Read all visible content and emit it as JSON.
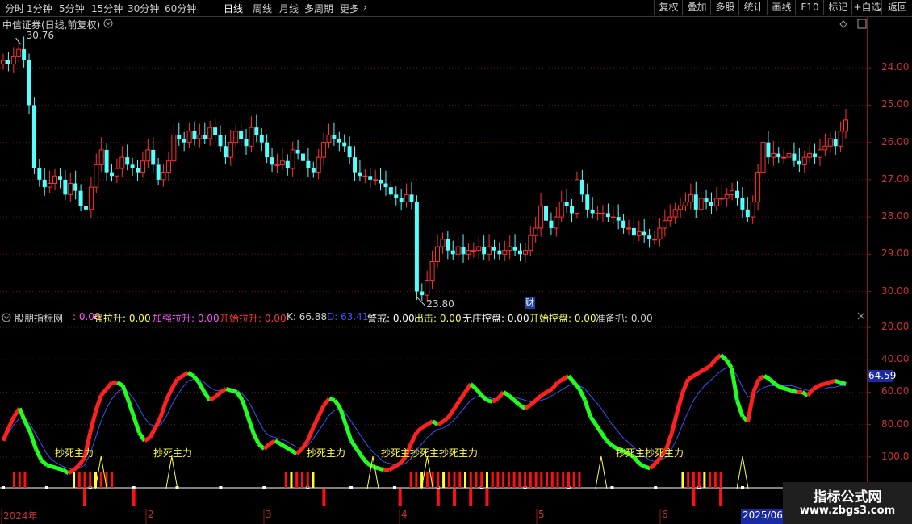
{
  "toolbar": {
    "timeframes": [
      "分时",
      "1分钟",
      "5分钟",
      "15分钟",
      "30分钟",
      "60分钟",
      "日线",
      "周线",
      "月线",
      "多周期",
      "更多"
    ],
    "active": "日线",
    "more_arrow": "›",
    "right_buttons": [
      "复权",
      "叠加",
      "多股",
      "统计",
      "画线",
      "F10",
      "标记",
      "+自选",
      "返回"
    ]
  },
  "price_panel": {
    "title": "中信证券(日线,前复权)",
    "title_menu_icon": "chevron-down-icon",
    "high_marker": "30.76",
    "low_marker": "23.80",
    "fin_marker": "财",
    "y_ticks": [
      "30.00",
      "29.00",
      "28.00",
      "27.00",
      "26.00",
      "25.00",
      "24.00"
    ]
  },
  "indicator_panel": {
    "name": "股朋指标网",
    "values": [
      {
        "label": "",
        "value": "0.00",
        "color": "#ff55ff"
      },
      {
        "label": "强拉升",
        "value": "0.00",
        "color": "#ffff55"
      },
      {
        "label": "加强拉升",
        "value": "0.00",
        "color": "#ff55ff"
      },
      {
        "label": "开始拉升",
        "value": "0.00",
        "color": "#ff3333"
      },
      {
        "label": "K",
        "value": "66.88",
        "color": "#d0d0d0"
      },
      {
        "label": "D",
        "value": "63.41",
        "color": "#3355ff"
      },
      {
        "label": "警戒",
        "value": "0.00",
        "color": "#ffffff"
      },
      {
        "label": "出击",
        "value": "0.00",
        "color": "#ffff55"
      },
      {
        "label": "无庄控盘",
        "value": "0.00",
        "color": "#ffffff"
      },
      {
        "label": "开始控盘",
        "value": "0.00",
        "color": "#ffff55"
      },
      {
        "label": "准备抓",
        "value": "0.00",
        "color": "#d0d0d0"
      }
    ],
    "y_ticks": [
      "100.0",
      "80.00",
      "60.00",
      "40.00",
      "20.00"
    ],
    "current_value": "64.59",
    "signal_label": "抄死主力"
  },
  "time_axis": [
    "2024年",
    "2",
    "3",
    "4",
    "5",
    "6"
  ],
  "cursor_date": "2025/06/1",
  "watermark": {
    "title": "指标公式网",
    "url": "www.zbgs3.com"
  },
  "chart_data": [
    {
      "type": "candlestick",
      "title": "中信证券(日线,前复权)",
      "ylim": [
        23.6,
        31.0
      ],
      "y_ticks": [
        24,
        25,
        26,
        27,
        28,
        29,
        30
      ],
      "high_label": 30.76,
      "low_label": 23.8,
      "close": [
        30.2,
        30.1,
        30.3,
        30.5,
        30.2,
        29.0,
        27.3,
        27.0,
        26.8,
        26.9,
        27.1,
        27.0,
        26.6,
        26.9,
        26.7,
        26.3,
        26.2,
        26.8,
        27.4,
        27.8,
        27.2,
        27.1,
        27.3,
        27.6,
        27.4,
        27.3,
        27.2,
        27.5,
        27.8,
        27.4,
        27.0,
        27.2,
        27.5,
        28.2,
        28.1,
        28.0,
        28.3,
        28.1,
        28.2,
        28.1,
        28.4,
        28.2,
        27.9,
        27.6,
        28.0,
        28.3,
        28.1,
        27.9,
        28.4,
        28.2,
        28.0,
        27.6,
        27.4,
        27.4,
        27.5,
        27.3,
        27.8,
        27.7,
        27.5,
        27.3,
        27.2,
        27.6,
        28.0,
        28.2,
        28.1,
        28.0,
        27.9,
        27.6,
        27.2,
        27.1,
        27.1,
        27.0,
        27.0,
        26.9,
        26.8,
        26.6,
        26.5,
        26.4,
        26.6,
        26.4,
        24.0,
        23.9,
        24.3,
        24.8,
        25.2,
        25.4,
        25.1,
        25.0,
        25.2,
        25.0,
        25.1,
        25.1,
        25.2,
        25.0,
        25.2,
        25.1,
        25.0,
        25.1,
        25.2,
        25.1,
        25.0,
        25.1,
        25.5,
        25.7,
        26.3,
        25.9,
        25.7,
        26.0,
        26.4,
        26.3,
        26.1,
        27.0,
        26.6,
        26.2,
        26.1,
        26.1,
        26.1,
        26.0,
        26.0,
        25.9,
        25.7,
        25.7,
        25.5,
        25.6,
        25.5,
        25.4,
        25.4,
        25.7,
        25.9,
        26.0,
        26.2,
        26.3,
        26.4,
        26.6,
        26.2,
        26.5,
        26.4,
        26.3,
        26.5,
        26.5,
        26.6,
        26.7,
        26.5,
        26.2,
        26.0,
        26.4,
        27.2,
        28.0,
        27.6,
        27.7,
        27.6,
        27.6,
        27.7,
        27.5,
        27.4,
        27.6,
        27.7,
        27.6,
        27.8,
        27.9,
        28.1,
        27.9,
        28.3,
        28.6
      ],
      "change_pct": []
    },
    {
      "type": "line",
      "title": "股朋指标网",
      "ylim": [
        0,
        110
      ],
      "y_ticks": [
        20,
        40,
        60,
        80,
        100
      ],
      "series": [
        {
          "name": "K",
          "values": [
            30,
            38,
            45,
            50,
            42,
            35,
            25,
            18,
            15,
            14,
            13,
            12,
            10,
            12,
            15,
            20,
            35,
            48,
            58,
            62,
            66,
            66,
            64,
            55,
            45,
            35,
            30,
            32,
            38,
            45,
            55,
            62,
            68,
            70,
            72,
            70,
            66,
            60,
            55,
            57,
            60,
            62,
            61,
            60,
            55,
            45,
            35,
            28,
            25,
            28,
            30,
            28,
            26,
            24,
            22,
            25,
            30,
            38,
            45,
            52,
            56,
            55,
            50,
            40,
            30,
            25,
            20,
            16,
            14,
            13,
            12,
            12,
            14,
            16,
            20,
            28,
            35,
            38,
            40,
            42,
            40,
            42,
            45,
            50,
            55,
            60,
            65,
            62,
            58,
            55,
            54,
            56,
            60,
            58,
            55,
            52,
            50,
            52,
            55,
            58,
            60,
            62,
            66,
            68,
            70,
            66,
            62,
            55,
            45,
            40,
            35,
            30,
            27,
            25,
            24,
            22,
            20,
            16,
            14,
            13,
            16,
            20,
            25,
            35,
            48,
            60,
            68,
            70,
            72,
            74,
            76,
            80,
            83,
            80,
            75,
            55,
            45,
            42,
            60,
            68,
            70,
            68,
            65,
            63,
            62,
            61,
            60,
            60,
            58,
            62,
            64,
            65,
            66,
            67,
            66,
            65
          ]
        },
        {
          "name": "D",
          "values": [
            32,
            35,
            40,
            44,
            43,
            40,
            34,
            28,
            22,
            18,
            16,
            14,
            13,
            12,
            13,
            15,
            22,
            32,
            42,
            50,
            56,
            60,
            62,
            60,
            56,
            50,
            44,
            40,
            39,
            40,
            45,
            52,
            58,
            63,
            67,
            68,
            68,
            66,
            63,
            61,
            61,
            61,
            61,
            61,
            59,
            55,
            49,
            42,
            36,
            33,
            32,
            31,
            30,
            28,
            26,
            26,
            27,
            31,
            36,
            41,
            46,
            49,
            50,
            47,
            42,
            37,
            32,
            27,
            23,
            20,
            17,
            16,
            15,
            15,
            16,
            19,
            24,
            28,
            32,
            35,
            37,
            38,
            40,
            43,
            47,
            51,
            55,
            57,
            58,
            57,
            56,
            56,
            57,
            57,
            57,
            56,
            55,
            54,
            54,
            55,
            56,
            58,
            60,
            62,
            64,
            65,
            64,
            62,
            58,
            54,
            50,
            45,
            40,
            36,
            32,
            29,
            26,
            23,
            20,
            18,
            17,
            18,
            20,
            25,
            32,
            40,
            48,
            55,
            60,
            64,
            67,
            70,
            73,
            75,
            75,
            70,
            63,
            57,
            58,
            61,
            63,
            64,
            64,
            64,
            64,
            64,
            63,
            62,
            61,
            61,
            62,
            62,
            63,
            63,
            64,
            64
          ]
        }
      ],
      "current_value": 64.59,
      "signal_labels": [
        "抄死主力",
        "抄死主力",
        "抄死主力",
        "抄死主抄死主抄死主力",
        "抄死主抄死主力"
      ]
    }
  ]
}
